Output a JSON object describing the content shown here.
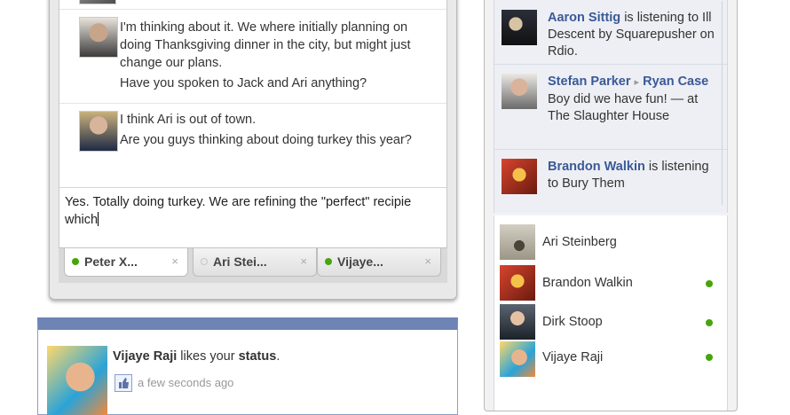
{
  "chat": {
    "messages": [
      {
        "lines": [
          "I'm thinking about it. We where initially planning on",
          "doing Thanksgiving dinner in the city, but might just",
          "change our plans.",
          "Have you spoken to Jack and Ari anything?"
        ]
      },
      {
        "lines": [
          "I think Ari is out of town.",
          "Are you guys thinking about doing turkey this year?"
        ]
      }
    ],
    "composer_text": "Yes. Totally doing turkey. We are refining the \"perfect\" recipie which",
    "tabs": [
      {
        "label": "Peter X...",
        "online": true
      },
      {
        "label": "Ari Stei...",
        "online": false
      },
      {
        "label": "Vijaye...",
        "online": true
      }
    ],
    "close_glyph": "×"
  },
  "notification": {
    "name": "Vijaye Raji",
    "action": " likes your ",
    "object": "status",
    "period": ".",
    "time": "a few seconds ago"
  },
  "ticker": {
    "items": [
      {
        "name": "Aaron Sittig",
        "text": " is listening to Ill Descent by Squarepusher on Rdio."
      },
      {
        "name": "Stefan Parker",
        "arrow": "▸",
        "name2": "Ryan Case",
        "text": " Boy did we have fun! — at The Slaughter House"
      },
      {
        "name": "Brandon Walkin",
        "text": " is listening to Bury Them"
      }
    ]
  },
  "friends": [
    {
      "name": "Ari Steinberg",
      "online": false
    },
    {
      "name": "Brandon Walkin",
      "online": true
    },
    {
      "name": "Dirk Stoop",
      "online": true
    },
    {
      "name": "Vijaye Raji",
      "online": true
    }
  ],
  "colors": {
    "online": "#47a50c",
    "link": "#3b5998",
    "notif_header": "#6d84b4"
  }
}
